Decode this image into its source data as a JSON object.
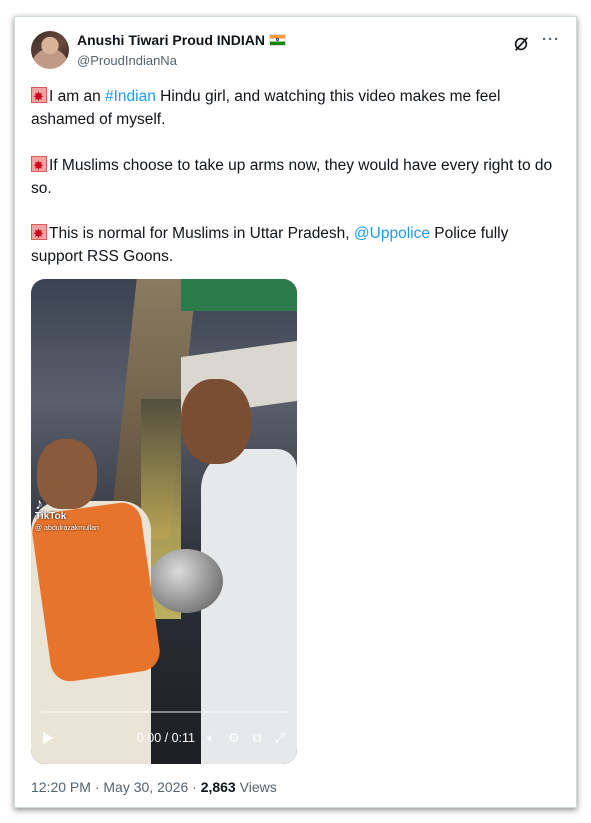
{
  "author": {
    "name": "Anushi Tiwari Proud INDIAN",
    "handle": "@ProudIndianNa",
    "flag_icon": "india-flag-icon"
  },
  "tweet": {
    "p1_before": "I am an ",
    "p1_hashtag": "#Indian",
    "p1_after": " Hindu girl, and watching this video makes me feel ashamed of myself.",
    "p2": "If Muslims choose to take up arms now, they would have every right to do so.",
    "p3_before": "This is normal for Muslims in Uttar Pradesh, ",
    "p3_mention": "@Uppolice",
    "p3_after": " Police fully support RSS Goons.",
    "siren_icon": "police-siren-icon"
  },
  "video": {
    "watermark_brand": "TikTok",
    "watermark_user": "@ abdulrazakmullan",
    "time": "0:00 / 0:11",
    "progress": 0
  },
  "meta": {
    "time": "12:20 PM",
    "date": "May 30, 2026",
    "views_count": "2,863",
    "views_label": "Views"
  },
  "colors": {
    "link": "#1d9bf0",
    "text": "#0f1419",
    "muted": "#536471"
  }
}
